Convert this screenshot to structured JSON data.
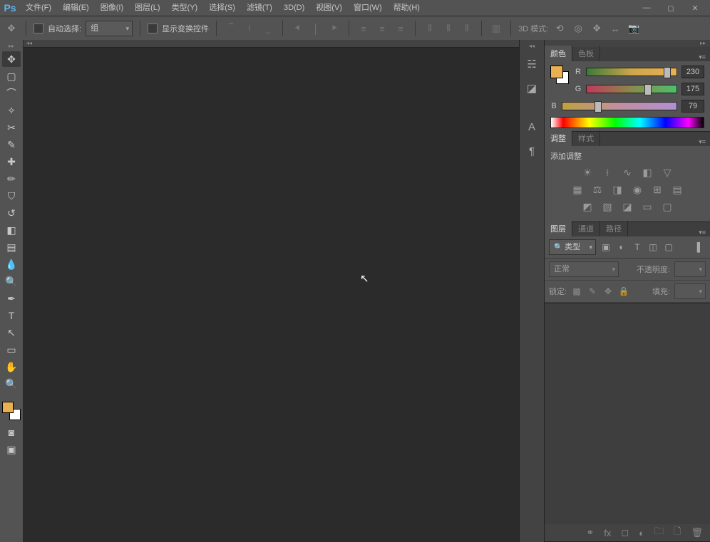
{
  "app_logo": "Ps",
  "menu": [
    "文件(F)",
    "编辑(E)",
    "图像(I)",
    "图层(L)",
    "类型(Y)",
    "选择(S)",
    "滤镜(T)",
    "3D(D)",
    "视图(V)",
    "窗口(W)",
    "帮助(H)"
  ],
  "options": {
    "auto_select_label": "自动选择:",
    "auto_select_value": "组",
    "show_transform_label": "显示变换控件",
    "mode3d_label": "3D 模式:"
  },
  "panels": {
    "color": {
      "tabs": [
        "颜色",
        "色板"
      ],
      "r_label": "R",
      "r_value": "230",
      "g_label": "G",
      "g_value": "175",
      "b_label": "B",
      "b_value": "79",
      "fg_color": "#e8b050",
      "bg_color": "#ffffff"
    },
    "adjust": {
      "tabs": [
        "调整",
        "样式"
      ],
      "add_label": "添加调整"
    },
    "layers": {
      "tabs": [
        "图层",
        "通道",
        "路径"
      ],
      "kind_label": "类型",
      "blend_value": "正常",
      "opacity_label": "不透明度:",
      "lock_label": "锁定:",
      "fill_label": "填充:"
    }
  }
}
